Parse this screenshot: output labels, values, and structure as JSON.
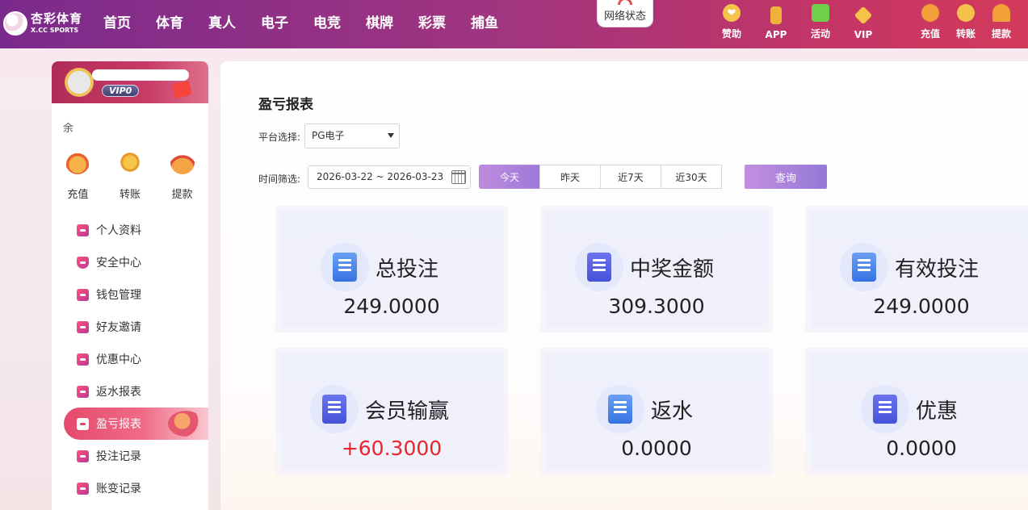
{
  "header": {
    "logo_cn": "杏彩体育",
    "logo_en": "X.CC SPORTS",
    "nav": [
      "首页",
      "体育",
      "真人",
      "电子",
      "电竞",
      "棋牌",
      "彩票",
      "捕鱼"
    ],
    "network_status": "网络状态",
    "icons_group1": [
      {
        "label": "赞助",
        "icon": "heart-handshake-icon",
        "color": "#f6c34a"
      },
      {
        "label": "APP",
        "icon": "phone-icon",
        "color": "#f0b13a"
      },
      {
        "label": "活动",
        "icon": "gift-icon",
        "color": "#6fcf4b"
      },
      {
        "label": "VIP",
        "icon": "diamond-icon",
        "color": "#f6c34a"
      }
    ],
    "icons_group2": [
      {
        "label": "充值",
        "icon": "money-bag-icon",
        "color": "#f2a03a"
      },
      {
        "label": "转账",
        "icon": "transfer-icon",
        "color": "#f4c24a"
      },
      {
        "label": "提款",
        "icon": "withdraw-fan-icon",
        "color": "#f2a03a"
      }
    ]
  },
  "sidebar": {
    "vip_label": "VIP0",
    "balance_label": "余",
    "quick_actions": [
      {
        "label": "充值",
        "icon": "money-bag-icon"
      },
      {
        "label": "转账",
        "icon": "transfer-icon"
      },
      {
        "label": "提款",
        "icon": "withdraw-fan-icon"
      }
    ],
    "menu": [
      {
        "label": "个人资料",
        "name": "sidebar-item-profile"
      },
      {
        "label": "安全中心",
        "name": "sidebar-item-security"
      },
      {
        "label": "钱包管理",
        "name": "sidebar-item-wallet"
      },
      {
        "label": "好友邀请",
        "name": "sidebar-item-invite"
      },
      {
        "label": "优惠中心",
        "name": "sidebar-item-promotions"
      },
      {
        "label": "返水报表",
        "name": "sidebar-item-rebate-report"
      },
      {
        "label": "盈亏报表",
        "name": "sidebar-item-profit-report",
        "active": true
      },
      {
        "label": "投注记录",
        "name": "sidebar-item-bet-records"
      },
      {
        "label": "账变记录",
        "name": "sidebar-item-transactions"
      }
    ]
  },
  "main": {
    "title": "盈亏报表",
    "platform_label": "平台选择:",
    "platform_value": "PG电子",
    "time_label": "时间筛选:",
    "date_range": "2026-03-22 ~ 2026-03-23",
    "range_tabs": [
      "今天",
      "昨天",
      "近7天",
      "近30天"
    ],
    "active_range": "今天",
    "query_label": "查询",
    "cards": [
      {
        "title": "总投注",
        "value": "249.0000",
        "icon": "total-bet-icon"
      },
      {
        "title": "中奖金额",
        "value": "309.3000",
        "icon": "prize-amount-icon"
      },
      {
        "title": "有效投注",
        "value": "249.0000",
        "icon": "valid-bet-icon"
      },
      {
        "title": "会员输赢",
        "value": "+60.3000",
        "icon": "member-winloss-icon",
        "positive": true
      },
      {
        "title": "返水",
        "value": "0.0000",
        "icon": "rebate-icon"
      },
      {
        "title": "优惠",
        "value": "0.0000",
        "icon": "discount-icon"
      }
    ],
    "positive_color": "#e8262c"
  }
}
